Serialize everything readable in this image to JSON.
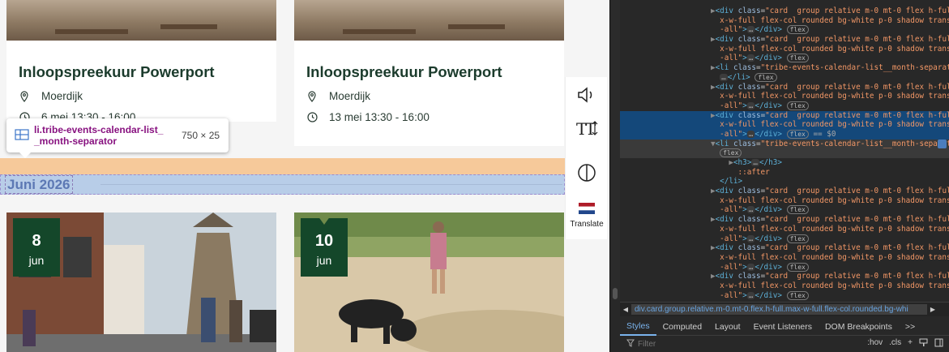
{
  "events": {
    "card1": {
      "title": "Inloopspreekuur Powerport",
      "location": "Moerdijk",
      "time": "6 mei 13:30 - 16:00"
    },
    "card2": {
      "title": "Inloopspreekuur Powerport",
      "location": "Moerdijk",
      "time": "13 mei 13:30 - 16:00"
    },
    "badge1": {
      "day": "8",
      "month": "jun"
    },
    "badge2": {
      "day": "10",
      "month": "jun"
    }
  },
  "separator": {
    "heading": "Juni 2026"
  },
  "tooltip": {
    "selector_line1": "li.tribe-events-calendar-list_",
    "selector_line2": "_month-separator",
    "size": "750 × 25"
  },
  "side_tools": {
    "translate_label": "Translate"
  },
  "devtools": {
    "tree": [
      {
        "indent": 10,
        "arrow": "▶",
        "tag": "div",
        "cls": "card  group relative m-0 mt-0 flex h-full ma",
        "state": "normal"
      },
      {
        "indent": 11,
        "cont": "x-w-full flex-col rounded bg-white p-0 shadow transition",
        "state": "normal"
      },
      {
        "indent": 11,
        "cont": "-all\">",
        "end": "div",
        "pill": "flex",
        "state": "normal"
      },
      {
        "indent": 10,
        "arrow": "▶",
        "tag": "div",
        "cls": "card  group relative m-0 mt-0 flex h-full ma",
        "state": "normal"
      },
      {
        "indent": 11,
        "cont": "x-w-full flex-col rounded bg-white p-0 shadow transition",
        "state": "normal"
      },
      {
        "indent": 11,
        "cont": "-all\">",
        "end": "div",
        "pill": "flex",
        "state": "normal"
      },
      {
        "indent": 10,
        "arrow": "▶",
        "tag": "li",
        "cls": "tribe-events-calendar-list__month-separator\">",
        "state": "normal",
        "raw": true
      },
      {
        "indent": 11,
        "cont": "",
        "end": "li",
        "pill": "flex",
        "state": "normal"
      },
      {
        "indent": 10,
        "arrow": "▶",
        "tag": "div",
        "cls": "card  group relative m-0 mt-0 flex h-full ma",
        "state": "normal"
      },
      {
        "indent": 11,
        "cont": "x-w-full flex-col rounded bg-white p-0 shadow transition",
        "state": "normal"
      },
      {
        "indent": 11,
        "cont": "-all\">",
        "end": "div",
        "pill": "flex",
        "state": "normal"
      },
      {
        "indent": 10,
        "arrow": "▶",
        "tag": "div",
        "cls": "card  group relative m-0 mt-0 flex h-full ma",
        "state": "sel",
        "dots": "…"
      },
      {
        "indent": 11,
        "cont": "x-w-full flex-col rounded bg-white p-0 shadow transition",
        "state": "sel"
      },
      {
        "indent": 11,
        "cont": "-all\">",
        "end": "div",
        "pill": "flex",
        "state": "sel",
        "eq": "== $0"
      },
      {
        "indent": 10,
        "arrow": "▼",
        "tag": "li",
        "cls": "tribe-events-calendar-list__month-separator\">",
        "state": "hov",
        "raw": true,
        "pin": true
      },
      {
        "indent": 11,
        "pillonly": "flex",
        "state": "hov"
      },
      {
        "indent": 12,
        "arrow": "▶",
        "tag": "h3",
        "h3": true,
        "state": "normal"
      },
      {
        "indent": 13,
        "pseudo": "::after",
        "state": "normal"
      },
      {
        "indent": 11,
        "close": "li",
        "state": "normal"
      },
      {
        "indent": 10,
        "arrow": "▶",
        "tag": "div",
        "cls": "card  group relative m-0 mt-0 flex h-full ma",
        "state": "normal"
      },
      {
        "indent": 11,
        "cont": "x-w-full flex-col rounded bg-white p-0 shadow transition",
        "state": "normal"
      },
      {
        "indent": 11,
        "cont": "-all\">",
        "end": "div",
        "pill": "flex",
        "state": "normal"
      },
      {
        "indent": 10,
        "arrow": "▶",
        "tag": "div",
        "cls": "card  group relative m-0 mt-0 flex h-full ma",
        "state": "normal"
      },
      {
        "indent": 11,
        "cont": "x-w-full flex-col rounded bg-white p-0 shadow transition",
        "state": "normal"
      },
      {
        "indent": 11,
        "cont": "-all\">",
        "end": "div",
        "pill": "flex",
        "state": "normal"
      },
      {
        "indent": 10,
        "arrow": "▶",
        "tag": "div",
        "cls": "card  group relative m-0 mt-0 flex h-full ma",
        "state": "normal"
      },
      {
        "indent": 11,
        "cont": "x-w-full flex-col rounded bg-white p-0 shadow transition",
        "state": "normal"
      },
      {
        "indent": 11,
        "cont": "-all\">",
        "end": "div",
        "pill": "flex",
        "state": "normal"
      },
      {
        "indent": 10,
        "arrow": "▶",
        "tag": "div",
        "cls": "card  group relative m-0 mt-0 flex h-full ma",
        "state": "normal"
      },
      {
        "indent": 11,
        "cont": "x-w-full flex-col rounded bg-white p-0 shadow transition",
        "state": "normal"
      },
      {
        "indent": 11,
        "cont": "-all\">",
        "end": "div",
        "pill": "flex",
        "state": "normal"
      }
    ],
    "breadcrumb": "div.card.group.relative.m-0.mt-0.flex.h-full.max-w-full.flex-col.rounded.bg-whi",
    "tabs": [
      "Styles",
      "Computed",
      "Layout",
      "Event Listeners",
      "DOM Breakpoints",
      ">>"
    ],
    "filter_placeholder": "Filter",
    "filter_tools": [
      ":hov",
      ".cls",
      "+"
    ]
  },
  "colors": {
    "brand_green": "#14472a",
    "title_green": "#1b3b2c",
    "selection": "#14487a"
  }
}
